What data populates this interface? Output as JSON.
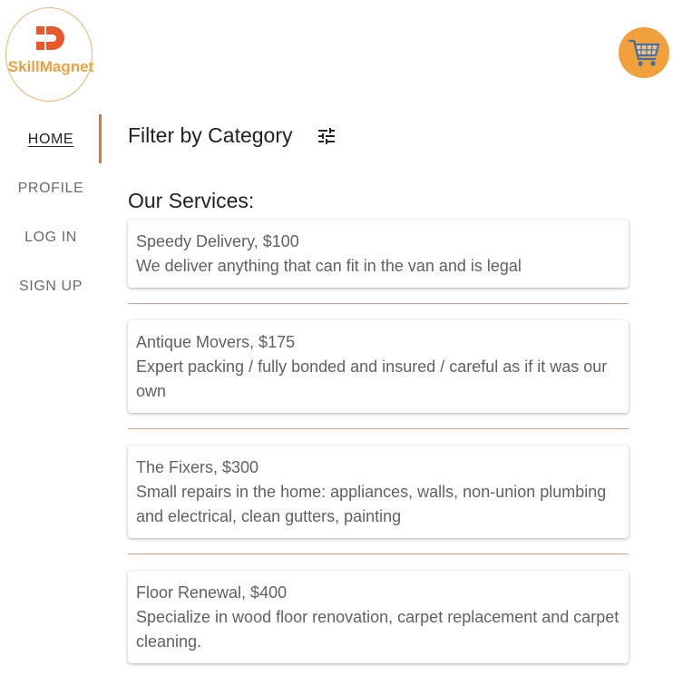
{
  "brand": {
    "logo_text": "SkillMagnet",
    "accent": "#f0a040",
    "logo_mark_color": "#e8582a"
  },
  "header": {
    "cart_icon": "shopping-cart-icon",
    "cart_bg": "#f2a03c"
  },
  "sidebar": {
    "items": [
      {
        "label": "HOME",
        "active": true
      },
      {
        "label": "PROFILE"
      },
      {
        "label": "LOG IN"
      },
      {
        "label": "SIGN UP"
      }
    ],
    "indicator_color": "#e0753a"
  },
  "main": {
    "filter_label": "Filter by Category",
    "filter_icon": "tune-icon",
    "section_title": "Our Services:",
    "services": [
      {
        "title": "Speedy Delivery, $100",
        "description": "We deliver anything that can fit in the van and is legal"
      },
      {
        "title": "Antique Movers, $175",
        "description": "Expert packing / fully bonded and insured / careful as if it was our own"
      },
      {
        "title": "The Fixers, $300",
        "description": "Small repairs in the home: appliances, walls, non-union plumbing and electrical, clean gutters, painting"
      },
      {
        "title": "Floor Renewal, $400",
        "description": "Specialize in wood floor renovation, carpet replacement and carpet cleaning."
      }
    ]
  }
}
